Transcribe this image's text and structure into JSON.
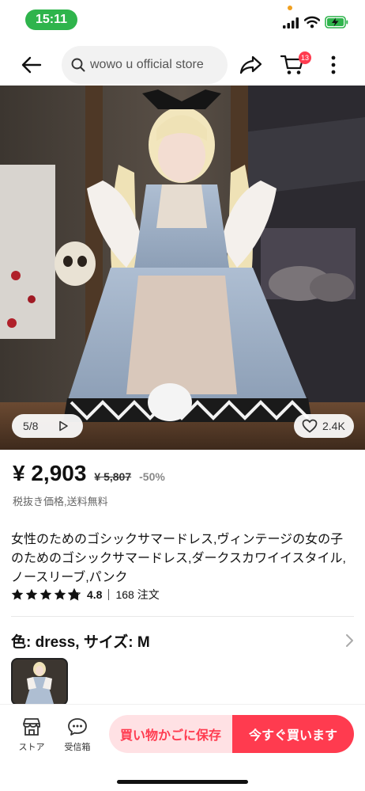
{
  "status_bar": {
    "time": "15:11",
    "time_pill_color": "#2fb44c"
  },
  "header": {
    "search_text": "wowo u official store",
    "cart_count": "13",
    "icons": [
      "back-arrow-icon",
      "search-icon",
      "share-icon",
      "cart-icon",
      "more-vertical-icon"
    ]
  },
  "gallery": {
    "counter": "5/8",
    "likes": "2.4K",
    "icons": [
      "play-icon",
      "heart-icon"
    ]
  },
  "price": {
    "current": "¥ 2,903",
    "original": "¥ 5,807",
    "discount": "-50%",
    "note": "税抜き価格,送料無料"
  },
  "product": {
    "title": "女性のためのゴシックサマードレス,ヴィンテージの女の子のためのゴシックサマードレス,ダークスカワイイスタイル,ノースリーブ,パンク",
    "rating": "4.8",
    "rating_stars": 4.8,
    "orders": "168 注文"
  },
  "variant": {
    "label": "色: dress, サイズ: M"
  },
  "bottom_bar": {
    "store_label": "ストア",
    "inbox_label": "受信箱",
    "add_to_cart": "買い物かごに保存",
    "buy_now": "今すぐ買います",
    "accent_color": "#ff3b4f",
    "cart_button_bg": "#ffe1e4"
  }
}
